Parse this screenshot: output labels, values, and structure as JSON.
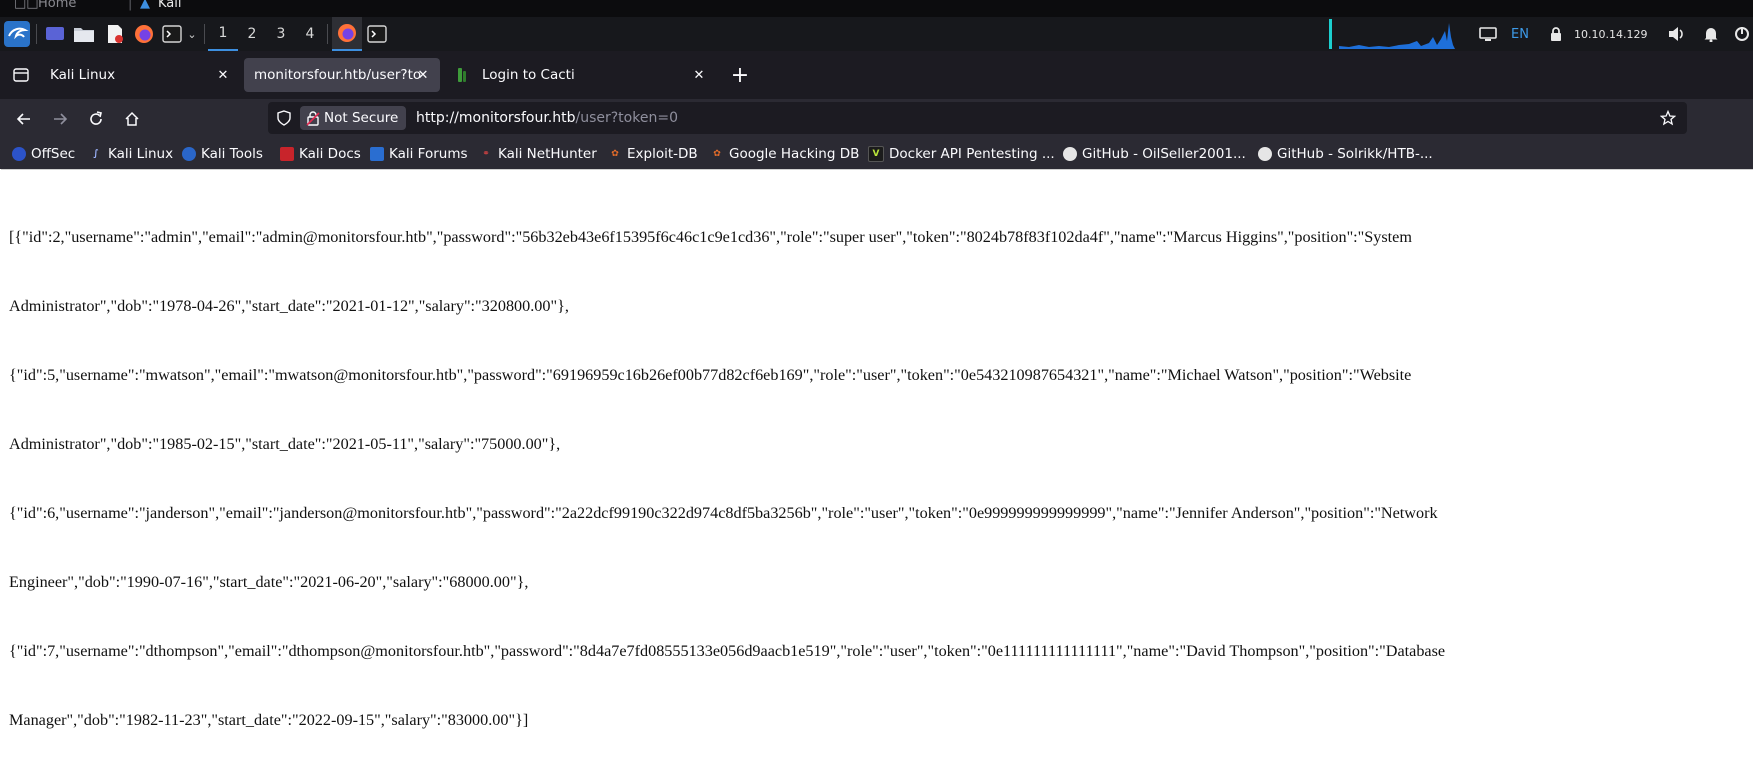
{
  "top_strip": {
    "title_1": "Home",
    "title_2": "Kali"
  },
  "panel": {
    "workspaces": [
      "1",
      "2",
      "3",
      "4"
    ],
    "active_workspace": "1",
    "keyboard_layout": "EN",
    "ip_address": "10.10.14.129"
  },
  "tabs": [
    {
      "label": "Kali Linux",
      "selected": false
    },
    {
      "label": "monitorsfour.htb/user?token=",
      "selected": true
    },
    {
      "label": "Login to Cacti",
      "selected": false
    }
  ],
  "navbar": {
    "security_label": "Not Secure",
    "url_host": "http://monitorsfour.htb",
    "url_path": "/user?token=0"
  },
  "bookmarks": [
    "OffSec",
    "Kali Linux",
    "Kali Tools",
    "Kali Docs",
    "Kali Forums",
    "Kali NetHunter",
    "Exploit-DB",
    "Google Hacking DB",
    "Docker API Pentesting ...",
    "GitHub - OilSeller2001...",
    "GitHub - Solrikk/HTB-..."
  ],
  "page": {
    "json_lines": [
      "[{\"id\":2,\"username\":\"admin\",\"email\":\"admin@monitorsfour.htb\",\"password\":\"56b32eb43e6f15395f6c46c1c9e1cd36\",\"role\":\"super user\",\"token\":\"8024b78f83f102da4f\",\"name\":\"Marcus Higgins\",\"position\":\"System",
      "Administrator\",\"dob\":\"1978-04-26\",\"start_date\":\"2021-01-12\",\"salary\":\"320800.00\"},",
      "{\"id\":5,\"username\":\"mwatson\",\"email\":\"mwatson@monitorsfour.htb\",\"password\":\"69196959c16b26ef00b77d82cf6eb169\",\"role\":\"user\",\"token\":\"0e543210987654321\",\"name\":\"Michael Watson\",\"position\":\"Website",
      "Administrator\",\"dob\":\"1985-02-15\",\"start_date\":\"2021-05-11\",\"salary\":\"75000.00\"},",
      "{\"id\":6,\"username\":\"janderson\",\"email\":\"janderson@monitorsfour.htb\",\"password\":\"2a22dcf99190c322d974c8df5ba3256b\",\"role\":\"user\",\"token\":\"0e999999999999999\",\"name\":\"Jennifer Anderson\",\"position\":\"Network",
      "Engineer\",\"dob\":\"1990-07-16\",\"start_date\":\"2021-06-20\",\"salary\":\"68000.00\"},",
      "{\"id\":7,\"username\":\"dthompson\",\"email\":\"dthompson@monitorsfour.htb\",\"password\":\"8d4a7e7fd08555133e056d9aacb1e519\",\"role\":\"user\",\"token\":\"0e111111111111111\",\"name\":\"David Thompson\",\"position\":\"Database",
      "Manager\",\"dob\":\"1982-11-23\",\"start_date\":\"2022-09-15\",\"salary\":\"83000.00\"}]"
    ]
  },
  "colors": {
    "panel_bg": "#17181c",
    "tabbar_bg": "#1c1b22",
    "toolbar_bg": "#2b2a33",
    "selected_tab_bg": "#42414d",
    "kali_accent": "#3d8fe0",
    "graph_color": "#1e6fd9",
    "url_dim": "#8f8f9d"
  }
}
